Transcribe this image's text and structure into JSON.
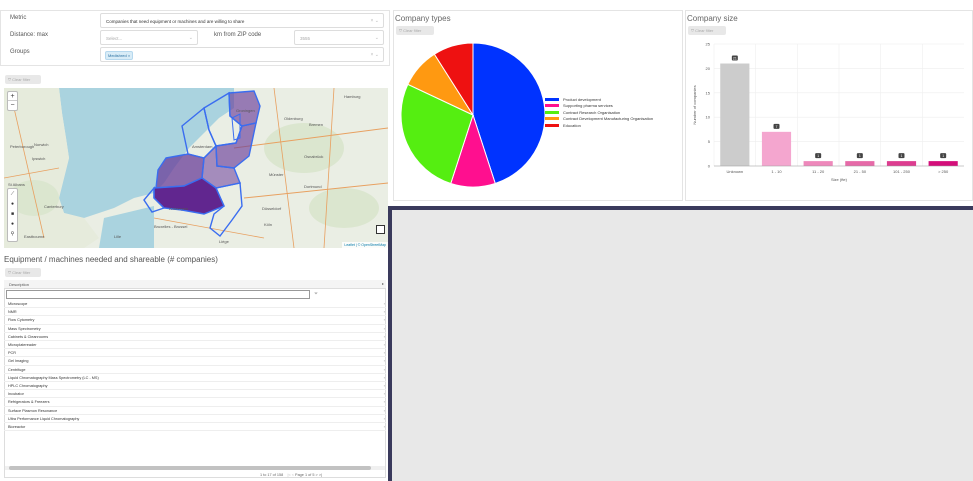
{
  "filters": {
    "metric_label": "Metric",
    "metric_value": "Companies that need equipment or machines and are willing to share",
    "distance_label": "Distance: max",
    "distance_placeholder": "Select...",
    "km_label": "km from ZIP code",
    "zip_placeholder": "3555",
    "groups_label": "Groups",
    "groups_tag": "Medishred"
  },
  "map": {
    "clear_filter": "Clear filter",
    "zoom_in": "+",
    "zoom_out": "−",
    "attribution": "Leaflet | © OpenStreetMap",
    "places": [
      "Hamburg",
      "Oldenburg",
      "Bremen",
      "Groningen",
      "Osnabrück",
      "Münster",
      "Dortmund",
      "Düsseldorf",
      "Köln",
      "Bruxelles - Brussel",
      "Antwerpen",
      "Amsterdam",
      "Norwich",
      "Ipswich",
      "Lille",
      "Liège",
      "Peterborough",
      "St Albans",
      "Canterbury",
      "Eastbourne"
    ]
  },
  "company_types": {
    "title": "Company types",
    "clear_filter": "Clear filter",
    "legend": [
      {
        "label": "Product development",
        "color": "#0033ff"
      },
      {
        "label": "Supporting pharma services",
        "color": "#ff0f8f"
      },
      {
        "label": "Contract Research Organisation",
        "color": "#55ee11"
      },
      {
        "label": "Contract Development Manufacturing Organisation",
        "color": "#ff9911"
      },
      {
        "label": "Education",
        "color": "#ee1111"
      }
    ]
  },
  "company_size": {
    "title": "Company size",
    "clear_filter": "Clear filter"
  },
  "chart_data": [
    {
      "type": "pie",
      "title": "Company types",
      "categories": [
        "Product development",
        "Supporting pharma services",
        "Contract Research Organisation",
        "Contract Development Manufacturing Organisation",
        "Education"
      ],
      "values": [
        45,
        10,
        27,
        9,
        9
      ],
      "colors": [
        "#0033ff",
        "#ff0f8f",
        "#55ee11",
        "#ff9911",
        "#ee1111"
      ]
    },
    {
      "type": "bar",
      "title": "Company size",
      "categories": [
        "Unknown",
        "1 - 10",
        "11 - 20",
        "21 - 50",
        "101 - 250",
        "> 250"
      ],
      "values": [
        21,
        7,
        1,
        1,
        1,
        1
      ],
      "colors": [
        "#cccccc",
        "#f4a6cf",
        "#ee88bb",
        "#e66aa8",
        "#dd3d90",
        "#d40e7a"
      ],
      "xlabel": "Size (fte)",
      "ylabel": "Number of companies",
      "ylim": [
        0,
        25
      ],
      "yticks": [
        0,
        5,
        10,
        15,
        20,
        25
      ],
      "grid": true
    }
  ],
  "equipment": {
    "title": "Equipment / machines needed and shareable (# companies)",
    "clear_filter": "Clear filter",
    "column_header": "Description",
    "rows": [
      "Microscope",
      "NMR",
      "Flow Cytometry",
      "Mass Spectrometry",
      "Cabinets & Cleanrooms",
      "Microplatereader",
      "PCR",
      "Gel Imaging",
      "Centrifuge",
      "Liquid Chromatography Mass Spectrometry (LC - MS)",
      "HPLC Chromatography",
      "Incubator",
      "Refrigerators & Freezers",
      "Surface Plasmon Resonance",
      "Ultra Performance Liquid Chromatography",
      "Bioreactor"
    ],
    "footer_count": "1 to 17 of 158",
    "footer_page": "Page 1 of 5",
    "pager_first": "|<",
    "pager_prev": "<",
    "pager_next": ">",
    "pager_last": ">|"
  }
}
